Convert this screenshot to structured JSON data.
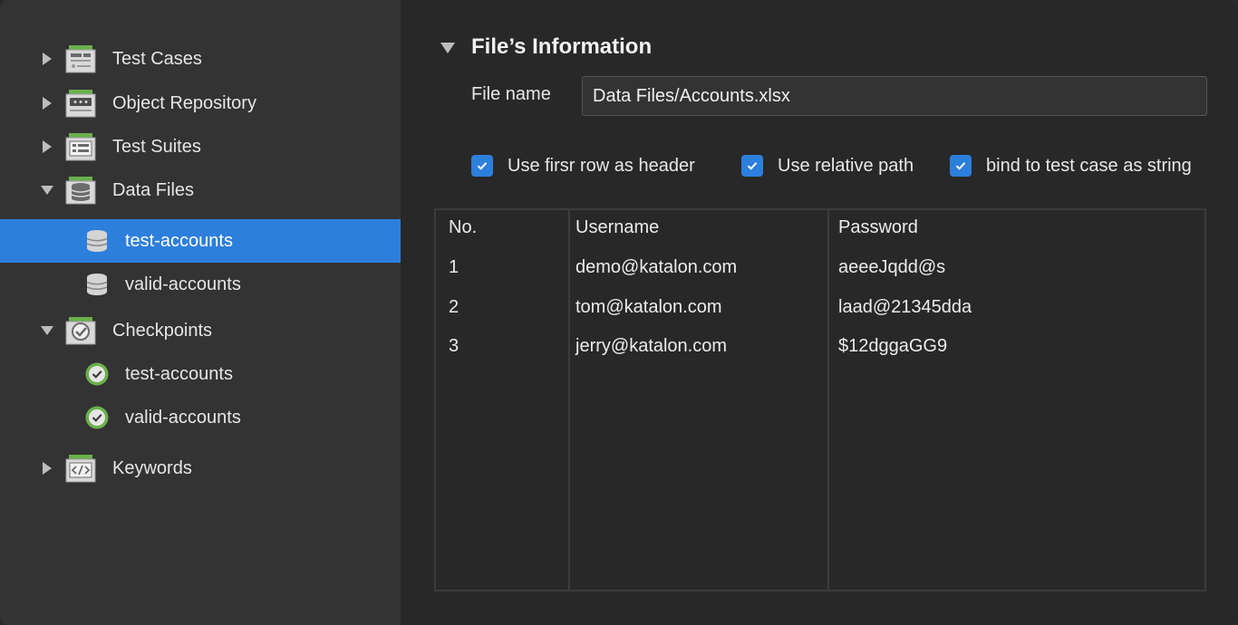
{
  "sidebar": {
    "items": [
      {
        "label": "Test Cases",
        "icon": "test-cases-icon",
        "expanded": false
      },
      {
        "label": "Object Repository",
        "icon": "object-repository-icon",
        "expanded": false
      },
      {
        "label": "Test Suites",
        "icon": "test-suites-icon",
        "expanded": false
      },
      {
        "label": "Data Files",
        "icon": "data-files-icon",
        "expanded": true,
        "children": [
          {
            "label": "test-accounts",
            "icon": "database-icon",
            "selected": true
          },
          {
            "label": "valid-accounts",
            "icon": "database-icon",
            "selected": false
          }
        ]
      },
      {
        "label": "Checkpoints",
        "icon": "checkpoints-icon",
        "expanded": true,
        "children": [
          {
            "label": "test-accounts",
            "icon": "checkpoint-check-icon"
          },
          {
            "label": "valid-accounts",
            "icon": "checkpoint-check-icon"
          }
        ]
      },
      {
        "label": "Keywords",
        "icon": "keywords-icon",
        "expanded": false
      }
    ]
  },
  "main": {
    "section_title": "File’s Information",
    "file_name_label": "File name",
    "file_name_value": "Data Files/Accounts.xlsx",
    "options": [
      {
        "label": "Use firsr row as header",
        "checked": true
      },
      {
        "label": "Use relative path",
        "checked": true
      },
      {
        "label": "bind to test case as string",
        "checked": true
      }
    ],
    "table": {
      "columns": [
        "No.",
        "Username",
        "Password"
      ],
      "rows": [
        [
          "1",
          "demo@katalon.com",
          "aeeeJqdd@s"
        ],
        [
          "2",
          "tom@katalon.com",
          "laad@21345dda"
        ],
        [
          "3",
          "jerry@katalon.com",
          "$12dggaGG9"
        ]
      ]
    }
  },
  "colors": {
    "accent": "#2d7fdc",
    "sidebar_bg": "#333333",
    "main_bg": "#282828",
    "icon_green": "#6ab04c"
  }
}
